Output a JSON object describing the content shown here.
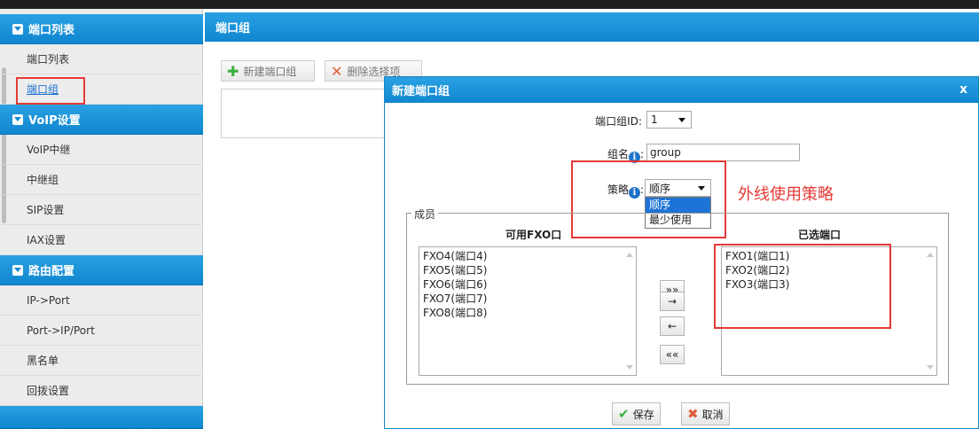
{
  "sidebar": {
    "sections": [
      {
        "title": "端口列表",
        "items": [
          "端口列表",
          "端口组"
        ]
      },
      {
        "title": "VoIP设置",
        "items": [
          "VoIP中继",
          "中继组",
          "SIP设置",
          "IAX设置"
        ]
      },
      {
        "title": "路由配置",
        "items": [
          "IP->Port",
          "Port->IP/Port",
          "黑名单",
          "回拨设置"
        ]
      }
    ]
  },
  "main": {
    "title": "端口组",
    "toolbar": {
      "new_label": "新建端口组",
      "delete_label": "删除选择项"
    }
  },
  "dialog": {
    "title": "新建端口组",
    "close_label": "x",
    "group_id_label": "端口组ID:",
    "group_id_value": "1",
    "group_name_label": "组名",
    "group_name_colon": ":",
    "group_name_value": "group",
    "strategy_label": "策略",
    "strategy_colon": ":",
    "strategy_value": "顺序",
    "strategy_options": [
      "顺序",
      "最少使用"
    ],
    "annotation": "外线使用策略",
    "members_legend": "成员",
    "available_title": "可用FXO口",
    "selected_title": "已选端口",
    "available": [
      "FXO4(端口4)",
      "FXO5(端口5)",
      "FXO6(端口6)",
      "FXO7(端口7)",
      "FXO8(端口8)"
    ],
    "selected": [
      "FXO1(端口1)",
      "FXO2(端口2)",
      "FXO3(端口3)"
    ],
    "move_buttons": [
      "»»",
      "→",
      "←",
      "««"
    ],
    "save_label": "保存",
    "cancel_label": "取消"
  },
  "colors": {
    "accent": "#1389d2",
    "annotation": "#e53935",
    "link": "#1a6fd4"
  }
}
